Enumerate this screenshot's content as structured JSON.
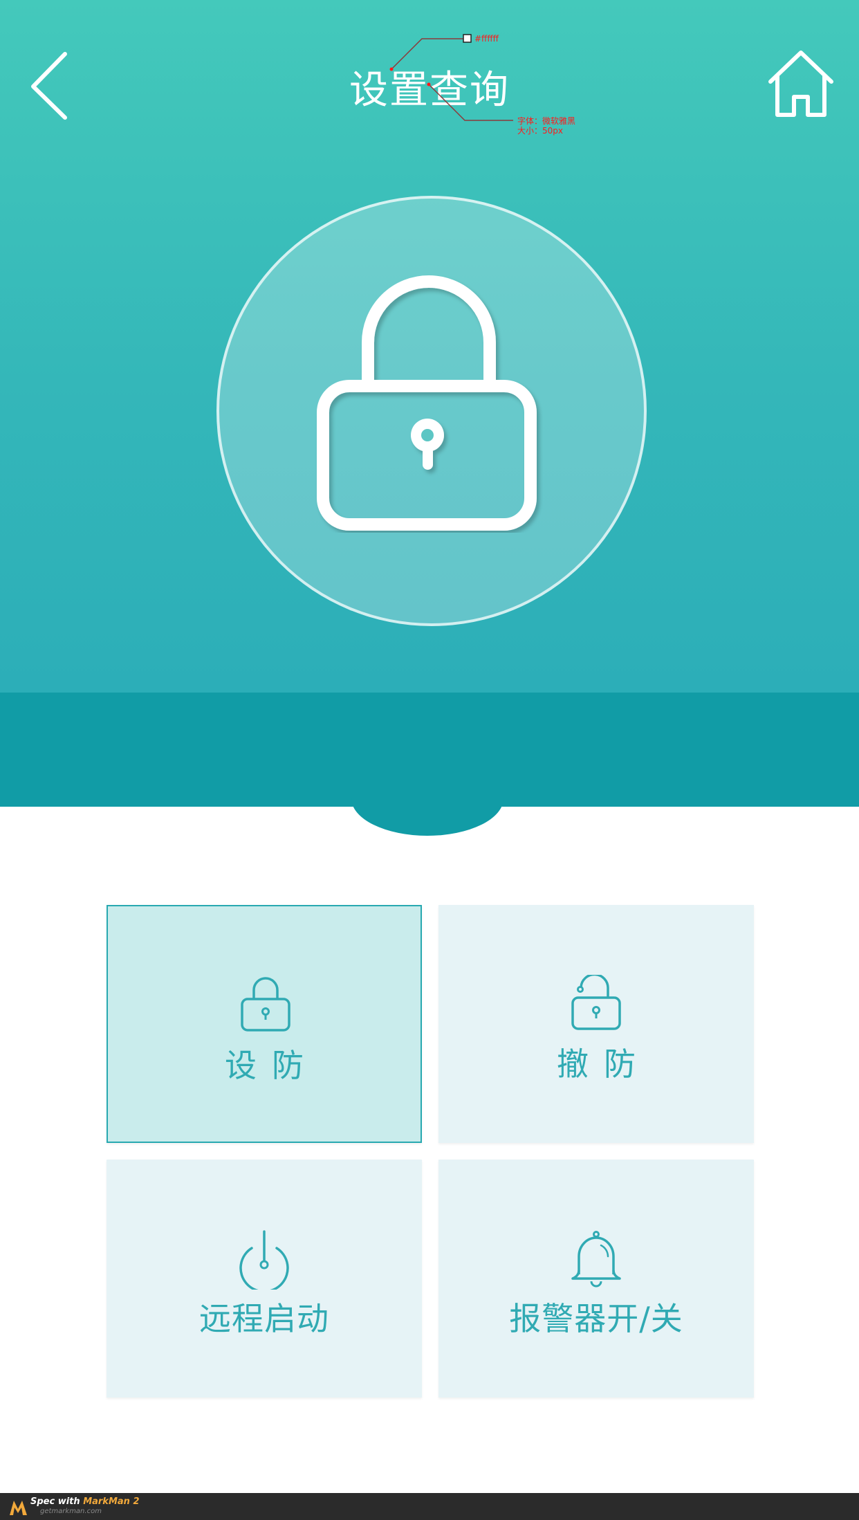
{
  "header": {
    "title": "设置查询",
    "back_icon": "chevron-left-icon",
    "home_icon": "home-icon"
  },
  "annotations": {
    "color_spec": "#ffffff",
    "font_spec": "字体：微软雅黑",
    "size_spec": "大小：50px"
  },
  "hero": {
    "icon": "padlock-icon"
  },
  "tiles": [
    {
      "label": "设防",
      "icon": "lock-icon",
      "active": true
    },
    {
      "label": "撤防",
      "icon": "unlock-icon",
      "active": false
    },
    {
      "label": "远程启动",
      "icon": "power-icon",
      "active": false
    },
    {
      "label": "报警器开/关",
      "icon": "bell-icon",
      "active": false
    }
  ],
  "footer": {
    "brand_prefix": "Spec with ",
    "brand_name": "MarkMan 2",
    "brand_site": "getmarkman.com"
  },
  "colors": {
    "hero_top": "#44c9bb",
    "hero_bottom": "#2caeb8",
    "band": "#119ca6",
    "tile_bg": "#e6f3f6",
    "tile_active_bg": "#c9ecec",
    "accent": "#30aab3"
  }
}
